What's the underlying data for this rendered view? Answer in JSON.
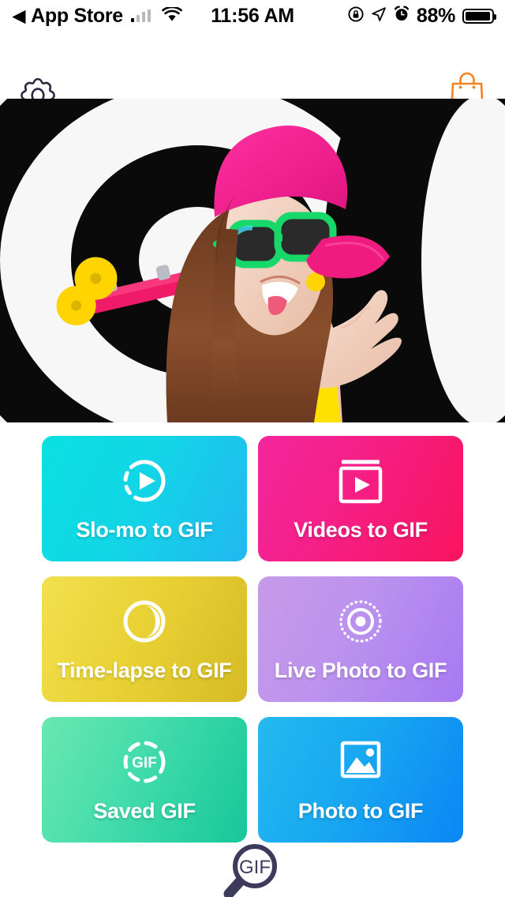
{
  "status_bar": {
    "back_arrow": "◀",
    "carrier_label": "App Store",
    "signal_icon": "cellular-bars-icon",
    "wifi_icon": "wifi-icon",
    "time": "11:56 AM",
    "rotation_lock_icon": "rotation-lock-icon",
    "location_icon": "location-arrow-icon",
    "alarm_icon": "alarm-clock-icon",
    "battery_percent": "88%",
    "battery_icon": "battery-icon"
  },
  "nav_bar": {
    "settings_icon": "gear-icon",
    "store_icon": "shopping-bag-icon",
    "store_icon_color": "#F58220",
    "settings_icon_color": "#2A2640"
  },
  "hero": {
    "alt": "Young woman in pink cap and green sunglasses holding a pink skateboard in front of a black and white target background",
    "icon": "hero-photo"
  },
  "tiles": [
    {
      "id": "slo-mo-to-gif",
      "label": "Slo-mo to GIF",
      "icon": "slow-motion-play-icon",
      "color_from": "#0AE0E0",
      "color_to": "#22B8F0"
    },
    {
      "id": "videos-to-gif",
      "label": "Videos to GIF",
      "icon": "video-frame-play-icon",
      "color_from": "#F3269C",
      "color_to": "#F8145E"
    },
    {
      "id": "time-lapse-to-gif",
      "label": "Time-lapse to GIF",
      "icon": "time-lapse-circle-icon",
      "color_from": "#F2E04E",
      "color_to": "#D6BB25"
    },
    {
      "id": "live-photo-to-gif",
      "label": "Live Photo to GIF",
      "icon": "live-photo-icon",
      "color_from": "#C79AE8",
      "color_to": "#A779F2"
    },
    {
      "id": "saved-gif",
      "label": "Saved GIF",
      "icon": "saved-gif-dashed-circle-icon",
      "icon_text": "GIF",
      "color_from": "#6AE8B0",
      "color_to": "#16C79A"
    },
    {
      "id": "photo-to-gif",
      "label": "Photo to GIF",
      "icon": "photo-image-icon",
      "color_from": "#25B9EF",
      "color_to": "#0B86F5"
    }
  ],
  "gif_search": {
    "icon": "gif-magnifier-icon",
    "label": "GIF",
    "color": "#3D3A5C"
  }
}
